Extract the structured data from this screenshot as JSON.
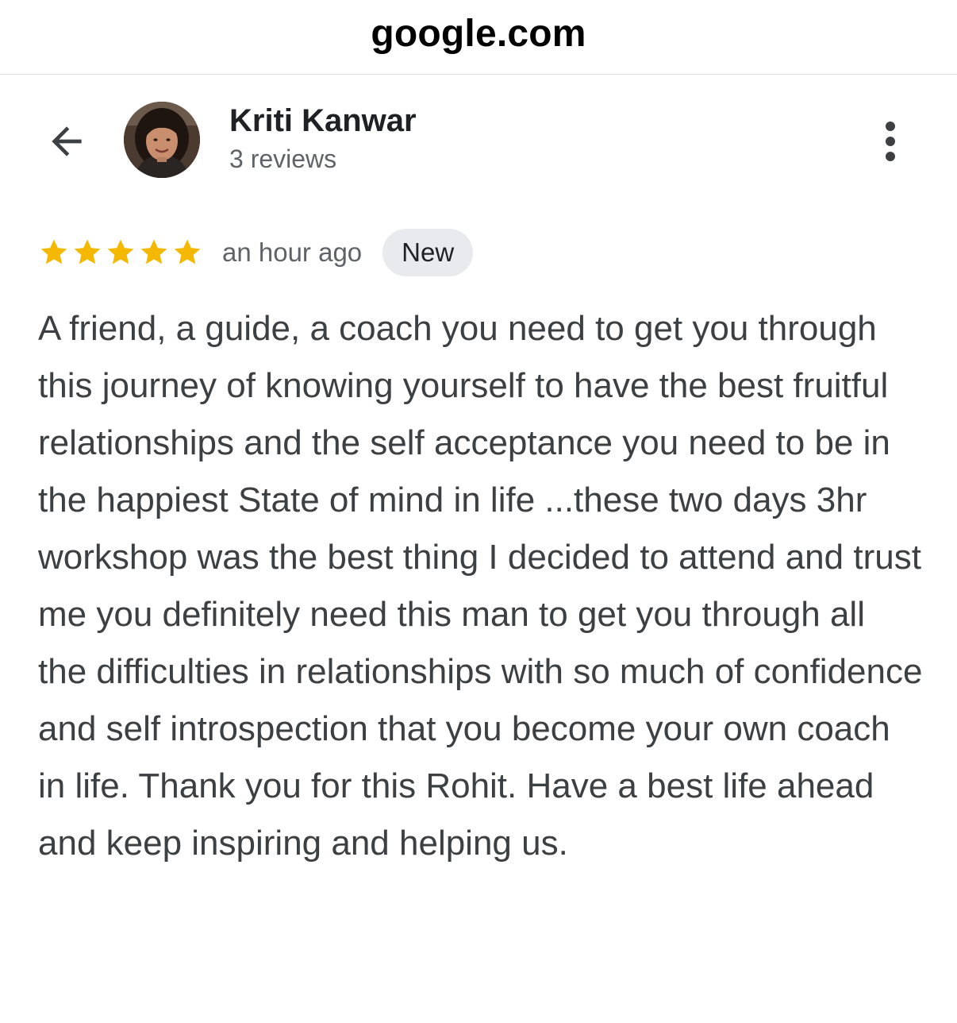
{
  "browser": {
    "domain": "google.com"
  },
  "header": {
    "back_icon": "arrow-back-icon",
    "reviewer_name": "Kriti Kanwar",
    "review_count": "3 reviews",
    "more_icon": "more-vert-icon"
  },
  "review": {
    "rating": 5,
    "rating_max": 5,
    "star_color": "#f5b800",
    "timestamp": "an hour ago",
    "badge": "New",
    "text": "A friend, a guide, a coach you need to get you through this journey of knowing yourself to have the best fruitful relationships and the self acceptance you need to be in the happiest State of mind in life ...these two days 3hr workshop was the best thing I decided to attend and trust me you definitely need this man to get you through all the difficulties in relationships with so much of confidence and self introspection that you become your own coach in life. Thank you for this Rohit. Have a best life ahead and keep inspiring and helping us."
  }
}
